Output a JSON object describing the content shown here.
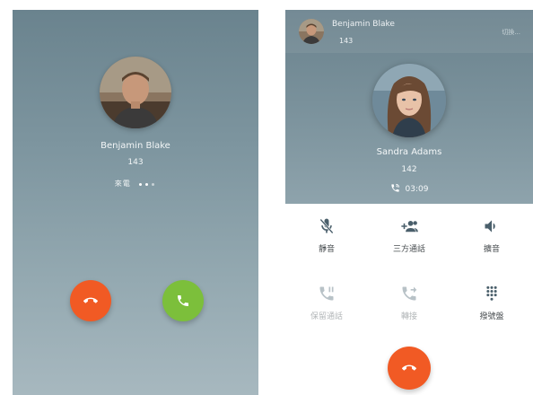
{
  "incoming_call": {
    "caller_name": "Benjamin Blake",
    "caller_number": "143",
    "status_text": "來電",
    "decline_icon": "phone-hangup-icon",
    "answer_icon": "phone-answer-icon",
    "colors": {
      "decline": "#f15a24",
      "answer": "#7cbf3b"
    }
  },
  "active_call": {
    "held_call": {
      "name": "Benjamin Blake",
      "number": "143",
      "action_label": "切換..."
    },
    "contact_name": "Sandra Adams",
    "contact_number": "142",
    "duration": "03:09",
    "controls": [
      {
        "label": "靜音",
        "icon": "mic-off-icon",
        "enabled": true
      },
      {
        "label": "三方通話",
        "icon": "add-participant-icon",
        "enabled": true
      },
      {
        "label": "擴音",
        "icon": "speaker-icon",
        "enabled": true
      },
      {
        "label": "保留通話",
        "icon": "phone-hold-icon",
        "enabled": false
      },
      {
        "label": "轉接",
        "icon": "phone-forward-icon",
        "enabled": false
      },
      {
        "label": "撥號盤",
        "icon": "dialpad-icon",
        "enabled": true
      }
    ],
    "hangup_icon": "phone-hangup-icon",
    "colors": {
      "hangup": "#f15a24"
    }
  }
}
